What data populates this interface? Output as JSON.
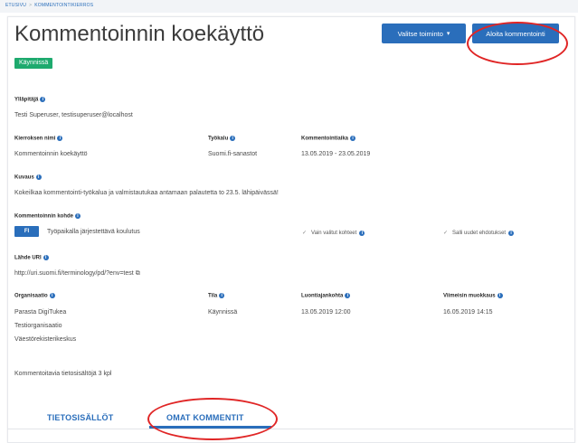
{
  "breadcrumb": {
    "home": "ETUSIVU",
    "separator": ">",
    "current": "KOMMENTOINTIKIERROS"
  },
  "page": {
    "title": "Kommentoinnin koekäyttö",
    "status": "Käynnissä",
    "actions_button": "Valitse toiminto",
    "start_button": "Aloita kommentointi"
  },
  "fields": {
    "admin_label": "Ylläpitäjä",
    "admin_value": "Testi Superuser, testisuperuser@localhost",
    "round_name_label": "Kierroksen nimi",
    "round_name_value": "Kommentoinnin koekäyttö",
    "tool_label": "Työkalu",
    "tool_value": "Suomi.fi-sanastot",
    "period_label": "Kommentointiaika",
    "period_value": "13.05.2019 - 23.05.2019",
    "description_label": "Kuvaus",
    "description_value": "Kokeilkaa kommentointi-työkalua ja valmistautukaa antamaan palautetta to 23.5. lähipäivässä!",
    "target_label": "Kommentoinnin kohde",
    "target_lang": "FI",
    "target_value": "Työpaikalla järjestettävä koulutus",
    "only_selected": "Vain valitut kohteet",
    "allow_new": "Salli uudet ehdotukset",
    "source_label": "Lähde URI",
    "source_value": "http://uri.suomi.fi/terminology/pd/?env=test",
    "org_label": "Organisaatio",
    "org_values": [
      "Parasta DigiTukea",
      "Testiorganisaatio",
      "Väestörekisterikeskus"
    ],
    "state_label": "Tila",
    "state_value": "Käynnissä",
    "created_label": "Luontiajankohta",
    "created_value": "13.05.2019 12:00",
    "modified_label": "Viimeisin muokkaus",
    "modified_value": "16.05.2019 14:15",
    "resource_count": "Kommentoitavia tietosisältöjä 3 kpl"
  },
  "tabs": [
    {
      "label": "TIETOSISÄLLÖT"
    },
    {
      "label": "OMAT KOMMENTIT"
    }
  ],
  "colors": {
    "primary": "#2a6ebb",
    "success": "#1eaa6e",
    "annotation": "#e02525"
  }
}
